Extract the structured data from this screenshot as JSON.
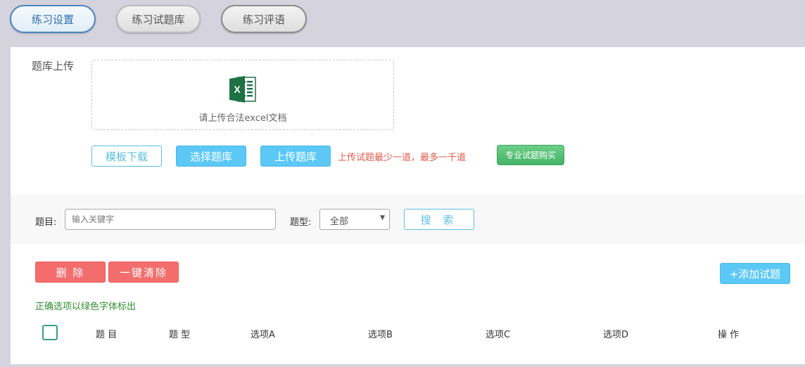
{
  "tabs": [
    {
      "label": "练习设置",
      "active": true
    },
    {
      "label": "练习试题库",
      "active": false
    },
    {
      "label": "练习评语",
      "active": false
    }
  ],
  "upload": {
    "label": "题库上传",
    "hint": "请上传合法excel文档",
    "icon": "excel-icon",
    "buttons": {
      "template": "模板下载",
      "choose": "选择题库",
      "upload": "上传题库",
      "buy": "专业试题购买"
    },
    "note": "上传试题最少一道，最多一千道"
  },
  "search": {
    "title_label": "题目:",
    "title_placeholder": "输入关键字",
    "type_label": "题型:",
    "type_value": "全部",
    "button": "搜 索"
  },
  "actions": {
    "delete": "删 除",
    "clear_all": "一键清除",
    "add": "+添加试题"
  },
  "legend_note": "正确选项以绿色字体标出",
  "table": {
    "columns": [
      "题 目",
      "题 型",
      "选项A",
      "选项B",
      "选项C",
      "选项D",
      "操 作"
    ]
  },
  "colors": {
    "accent_blue": "#5bc8f5",
    "danger_red": "#f46d6d",
    "buy_green": "#45b367",
    "note_red": "#e05b4a",
    "note_green": "#2f8f2f"
  }
}
